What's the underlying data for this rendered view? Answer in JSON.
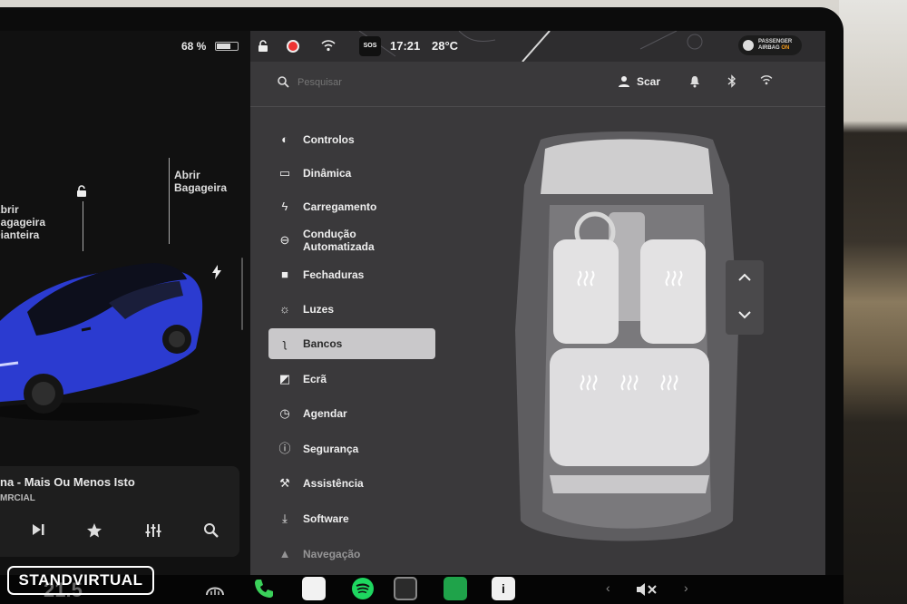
{
  "left_panel": {
    "battery_percent": "68 %",
    "battery_level": 0.68,
    "callout_frunk": "Abrir\nBagageira\nDianteira",
    "callout_trunk": "Abrir\nBagageira",
    "media": {
      "title": "na - Mais Ou Menos Isto",
      "subtitle": "MRCIAL",
      "controls": [
        "next-icon",
        "star-icon",
        "equalizer-icon",
        "search-icon"
      ]
    },
    "odometer_partial": "21.5"
  },
  "status_bar": {
    "sos": "SOS",
    "time": "17:21",
    "temperature": "28°C",
    "airbag_line1": "PASSENGER",
    "airbag_line2": "AIRBAG",
    "airbag_state": "ON"
  },
  "search": {
    "placeholder": "Pesquisar"
  },
  "profile": {
    "name": "Scar"
  },
  "menu": [
    {
      "label": "Controlos",
      "icon": "toggle-icon",
      "active": false
    },
    {
      "label": "Dinâmica",
      "icon": "car-icon",
      "active": false
    },
    {
      "label": "Carregamento",
      "icon": "bolt-icon",
      "active": false
    },
    {
      "label": "Condução\nAutomatizada",
      "icon": "steering-wheel-icon",
      "active": false
    },
    {
      "label": "Fechaduras",
      "icon": "lock-icon",
      "active": false
    },
    {
      "label": "Luzes",
      "icon": "sun-icon",
      "active": false
    },
    {
      "label": "Bancos",
      "icon": "seat-icon",
      "active": true
    },
    {
      "label": "Ecrã",
      "icon": "display-icon",
      "active": false
    },
    {
      "label": "Agendar",
      "icon": "clock-icon",
      "active": false
    },
    {
      "label": "Segurança",
      "icon": "alert-icon",
      "active": false
    },
    {
      "label": "Assistência",
      "icon": "wrench-icon",
      "active": false
    },
    {
      "label": "Software",
      "icon": "download-icon",
      "active": false
    },
    {
      "label": "Navegação",
      "icon": "navigation-icon",
      "active": false
    }
  ],
  "seats": {
    "heated_front_left": true,
    "heated_front_right": true,
    "heated_rear_left": true,
    "heated_rear_center": true,
    "heated_rear_right": true
  },
  "watermark": "STANDVIRTUAL",
  "colors": {
    "panel_bg": "#3a393b",
    "active_item": "#c9c8ca",
    "car_blue": "#2b3bd0",
    "airbag_on": "#f39c1c"
  }
}
